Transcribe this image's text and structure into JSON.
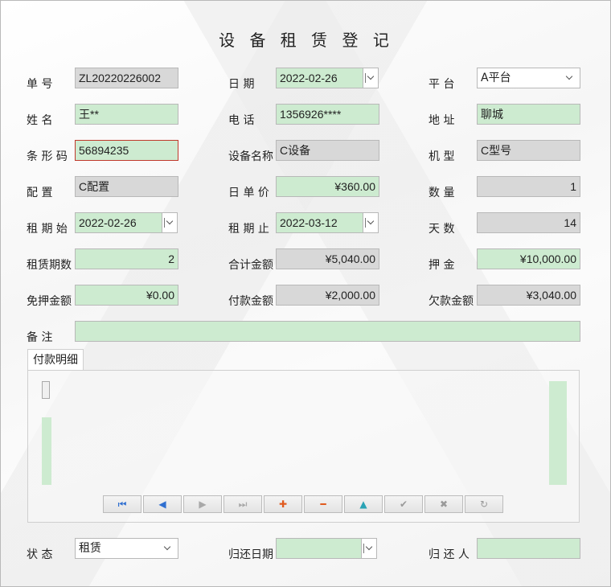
{
  "form": {
    "title": "设 备 租 赁 登 记",
    "order_no": {
      "label": "单    号",
      "value": "ZL20220226002"
    },
    "date": {
      "label": "日    期",
      "value": "2022-02-26"
    },
    "platform": {
      "label": "平    台",
      "value": "A平台"
    },
    "name": {
      "label": "姓    名",
      "value": "王**"
    },
    "phone": {
      "label": "电    话",
      "value": "1356926****"
    },
    "address": {
      "label": "地    址",
      "value": "聊城"
    },
    "barcode": {
      "label": "条 形 码",
      "value": "56894235"
    },
    "device_name": {
      "label": "设备名称",
      "value": "C设备"
    },
    "model": {
      "label": "机    型",
      "value": "C型号"
    },
    "config": {
      "label": "配    置",
      "value": "C配置"
    },
    "unit_price": {
      "label": "日 单 价",
      "value": "¥360.00"
    },
    "quantity": {
      "label": "数    量",
      "value": "1"
    },
    "rent_start": {
      "label": "租 期 始",
      "value": "2022-02-26"
    },
    "rent_end": {
      "label": "租 期 止",
      "value": "2022-03-12"
    },
    "days": {
      "label": "天    数",
      "value": "14"
    },
    "periods": {
      "label": "租赁期数",
      "value": "2"
    },
    "total": {
      "label": "合计金额",
      "value": "¥5,040.00"
    },
    "deposit": {
      "label": "押    金",
      "value": "¥10,000.00"
    },
    "deposit_free": {
      "label": "免押金额",
      "value": "¥0.00"
    },
    "paid": {
      "label": "付款金额",
      "value": "¥2,000.00"
    },
    "owed": {
      "label": "欠款金额",
      "value": "¥3,040.00"
    },
    "remark": {
      "label": "备    注",
      "value": ""
    },
    "status": {
      "label": "状    态",
      "value": "租赁"
    },
    "return_date": {
      "label": "归还日期",
      "value": ""
    },
    "returner": {
      "label": "归 还 人",
      "value": ""
    }
  },
  "tabs": [
    {
      "label": "付款明细"
    }
  ],
  "navigator": {
    "first": "⏮",
    "prev": "◀",
    "next": "▶",
    "last": "⏭",
    "add": "✚",
    "delete": "━",
    "edit": "▲",
    "post": "✔",
    "cancel": "✖",
    "refresh": "↻"
  },
  "colors": {
    "field_green": "#cdebd0",
    "field_gray": "#d8d8d8",
    "invalid_border": "#c0392b"
  }
}
